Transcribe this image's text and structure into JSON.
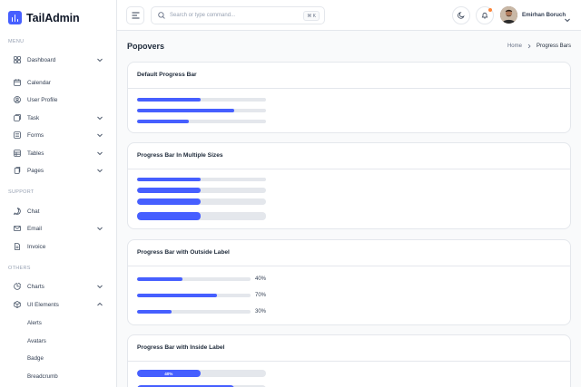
{
  "app": {
    "name": "TailAdmin"
  },
  "sidebar": {
    "groups": [
      "MENU",
      "SUPPORT",
      "OTHERS"
    ],
    "items": [
      {
        "label": "Dashboard",
        "icon": "grid-icon",
        "has_chevron": true
      },
      {
        "label": "Calendar",
        "icon": "calendar-icon",
        "has_chevron": false
      },
      {
        "label": "User Profile",
        "icon": "user-icon",
        "has_chevron": false
      },
      {
        "label": "Task",
        "icon": "task-icon",
        "has_chevron": true
      },
      {
        "label": "Forms",
        "icon": "forms-icon",
        "has_chevron": true
      },
      {
        "label": "Tables",
        "icon": "table-icon",
        "has_chevron": true
      },
      {
        "label": "Pages",
        "icon": "pages-icon",
        "has_chevron": true
      },
      {
        "label": "Chat",
        "icon": "chat-icon",
        "has_chevron": false
      },
      {
        "label": "Email",
        "icon": "mail-icon",
        "has_chevron": true
      },
      {
        "label": "Invoice",
        "icon": "invoice-icon",
        "has_chevron": false
      },
      {
        "label": "Charts",
        "icon": "pie-chart-icon",
        "has_chevron": true
      },
      {
        "label": "UI Elements",
        "icon": "cube-icon",
        "has_chevron": true,
        "expanded": true
      }
    ],
    "sub_items": [
      "Alerts",
      "Avatars",
      "Badge",
      "Breadcrumb"
    ]
  },
  "header": {
    "search_placeholder": "Search or type command...",
    "shortcut": "⌘ K",
    "user_name": "Emirhan Boruch"
  },
  "main": {
    "title": "Popovers",
    "breadcrumb": {
      "home": "Home",
      "current": "Progress Bars"
    },
    "cards": {
      "default": {
        "title": "Default Progress Bar",
        "values": [
          0.49,
          0.75,
          0.4
        ]
      },
      "sizes": {
        "title": "Progress Bar In Multiple Sizes",
        "values": [
          0.49,
          0.49,
          0.49,
          0.49
        ]
      },
      "outside": {
        "title": "Progress Bar with Outside Label",
        "bars": [
          {
            "value": 0.4,
            "label": "40%"
          },
          {
            "value": 0.7,
            "label": "70%"
          },
          {
            "value": 0.3,
            "label": "30%"
          }
        ]
      },
      "inside": {
        "title": "Progress Bar with Inside Label",
        "bars": [
          {
            "value": 0.49,
            "label": "40%"
          },
          {
            "value": 0.75,
            "label": ""
          }
        ]
      }
    }
  },
  "colors": {
    "accent": "#465fff",
    "track": "#e4e7ec",
    "notification": "#fd853a"
  }
}
